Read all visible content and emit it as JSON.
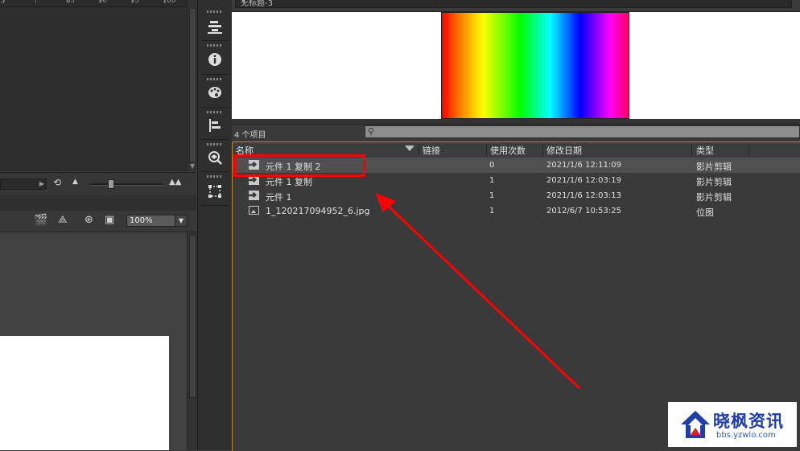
{
  "ruler": {
    "numbers": [
      "5",
      "85",
      "90",
      "95",
      "100"
    ]
  },
  "stage_toolbar": {
    "zoom_value": "100%"
  },
  "library": {
    "document_name": "无标题-3",
    "item_count": "4 个项目",
    "columns": {
      "name": "名称",
      "linkage": "链接",
      "use_count": "使用次数",
      "modified": "修改日期",
      "type": "类型"
    },
    "items": [
      {
        "name": "元件 1 复制 2",
        "uses": "0",
        "date": "2021/1/6 12:11:09",
        "type": "影片剪辑",
        "icon": "movieclip-symbol-icon",
        "selected": true
      },
      {
        "name": "元件 1 复制",
        "uses": "1",
        "date": "2021/1/6 12:03:19",
        "type": "影片剪辑",
        "icon": "movieclip-symbol-icon",
        "selected": false
      },
      {
        "name": "元件 1",
        "uses": "1",
        "date": "2021/1/6 12:03:13",
        "type": "影片剪辑",
        "icon": "movieclip-symbol-icon",
        "selected": false
      },
      {
        "name": "1_120217094952_6.jpg",
        "uses": "1",
        "date": "2012/6/7 10:53:25",
        "type": "位图",
        "icon": "bitmap-icon",
        "selected": false
      }
    ]
  },
  "toolstrip_icons": [
    "align-panel-icon",
    "info-icon",
    "color-palette-icon",
    "align-left-icon",
    "transform-icon",
    "free-transform-icon"
  ],
  "annotation": {
    "color": "#ff0000"
  },
  "watermark": {
    "title": "晓枫资讯",
    "url": "bbs.yzwlo.com",
    "color": "#1e3ea8"
  }
}
